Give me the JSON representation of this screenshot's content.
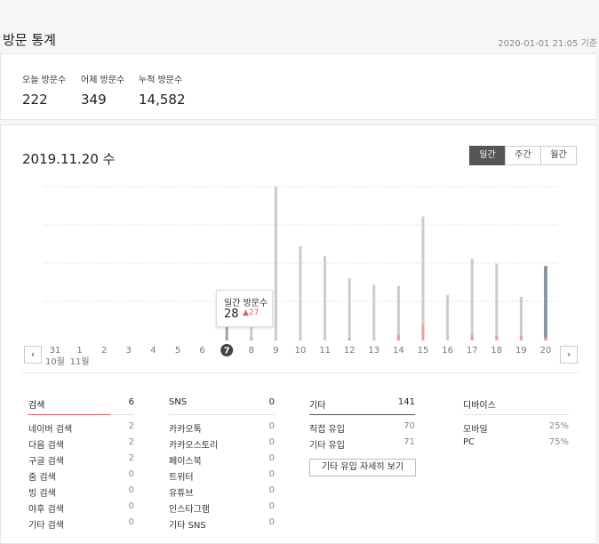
{
  "header": {
    "title": "방문 통계",
    "ref_time": "2020-01-01 21:05 기준"
  },
  "summary": [
    {
      "label": "오늘 방문수",
      "value": "222"
    },
    {
      "label": "어제 방문수",
      "value": "349"
    },
    {
      "label": "누적 방문수",
      "value": "14,582"
    }
  ],
  "main": {
    "date_title": "2019.11.20 수",
    "periods": [
      "일간",
      "주간",
      "월간"
    ],
    "active_period": "일간",
    "prev_label": "‹",
    "next_label": "›"
  },
  "chart_data": {
    "type": "bar",
    "categories": [
      "31",
      "1",
      "2",
      "3",
      "4",
      "5",
      "6",
      "7",
      "8",
      "9",
      "10",
      "11",
      "12",
      "13",
      "14",
      "15",
      "16",
      "17",
      "18",
      "19",
      "20"
    ],
    "month_labels": [
      {
        "index": 0,
        "text": "10월"
      },
      {
        "index": 1,
        "text": "11월"
      }
    ],
    "selected": "7",
    "series": [
      {
        "values": [
          0,
          0,
          0,
          0,
          0,
          0,
          0,
          28,
          92,
          310,
          190,
          170,
          125,
          112,
          110,
          250,
          92,
          165,
          155,
          88,
          150
        ]
      },
      {
        "values": [
          0,
          0,
          0,
          0,
          0,
          0,
          0,
          0,
          4,
          2,
          0,
          0,
          4,
          0,
          12,
          32,
          0,
          12,
          9,
          10,
          6
        ]
      }
    ],
    "ylim": [
      0,
      310
    ],
    "colors": {
      "total": "#c8ccd2",
      "inflow": "#f49b9b",
      "selected": "#9aa2b1",
      "today": "#8c95a4"
    }
  },
  "tooltip": {
    "label": "일간 방문수",
    "value": "28",
    "delta": "▲27"
  },
  "sources": [
    {
      "name": "검색",
      "count": "6",
      "items": [
        {
          "name": "네이버 검색",
          "count": "2"
        },
        {
          "name": "다음 검색",
          "count": "2"
        },
        {
          "name": "구글 검색",
          "count": "2"
        },
        {
          "name": "줌 검색",
          "count": "0"
        },
        {
          "name": "빙 검색",
          "count": "0"
        },
        {
          "name": "야후 검색",
          "count": "0"
        },
        {
          "name": "기타 검색",
          "count": "0"
        }
      ]
    },
    {
      "name": "SNS",
      "count": "0",
      "items": [
        {
          "name": "카카오톡",
          "count": "0"
        },
        {
          "name": "카카오스토리",
          "count": "0"
        },
        {
          "name": "페이스북",
          "count": "0"
        },
        {
          "name": "트위터",
          "count": "0"
        },
        {
          "name": "유튜브",
          "count": "0"
        },
        {
          "name": "인스타그램",
          "count": "0"
        },
        {
          "name": "기타 SNS",
          "count": "0"
        }
      ]
    },
    {
      "name": "기타",
      "count": "141",
      "items": [
        {
          "name": "직접 유입",
          "count": "70"
        },
        {
          "name": "기타 유입",
          "count": "71"
        }
      ],
      "button": "기타 유입 자세히 보기"
    },
    {
      "name": "디바이스",
      "count": "",
      "items": [
        {
          "name": "모바일",
          "count": "25%"
        },
        {
          "name": "PC",
          "count": "75%"
        }
      ]
    }
  ]
}
